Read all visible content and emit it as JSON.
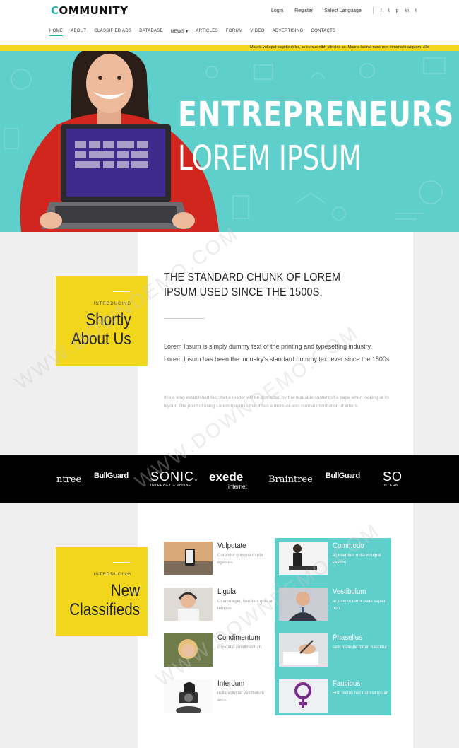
{
  "header": {
    "logo_first": "C",
    "logo_rest": "OMMUNITY",
    "login": "Login",
    "register": "Register",
    "language": "Select Language",
    "social": [
      "f",
      "t",
      "p",
      "in",
      "t"
    ]
  },
  "nav": {
    "items": [
      "HOME",
      "ABOUT",
      "CLASSIFIED ADS",
      "DATABASE",
      "NEWS ▾",
      "ARTICLES",
      "FORUM",
      "VIDEO",
      "ADVERTISING",
      "CONTACTS"
    ]
  },
  "ticker": {
    "text": "Mauris volutpat sagittis dolor, ac cursus nibh ultricies ac. Mauris lacinia nunc non venenatis aliquam. Aliq"
  },
  "hero": {
    "title1": "ENTREPRENEURS",
    "title2": "LOREM IPSUM"
  },
  "about": {
    "intro": "INTRODUCING",
    "title_line1": "Shortly",
    "title_line2": "About Us",
    "heading": "THE STANDARD CHUNK OF LOREM IPSUM USED SINCE THE 1500S.",
    "paragraph1": "Lorem Ipsum is simply dummy text of the printing and typesetting industry. Lorem Ipsum has been the industry's standard dummy text ever since the 1500s",
    "paragraph2": "It is a long established fact that a reader will be distracted by the readable content of a page when looking at its layout. The point of using Lorem Ipsum is that it has a more-or-less normal distribution of letters."
  },
  "brands": [
    "ntree",
    "BullGuard",
    "SONIC.",
    "INTERNET + PHONE",
    "exede",
    "internet",
    "Braintree",
    "BullGuard",
    "SO",
    "INTERN"
  ],
  "classifieds": {
    "intro": "INTRODUCING",
    "title_line1": "New",
    "title_line2": "Classifieds",
    "items": [
      {
        "title": "Vulputate",
        "desc": "Curabitur quisque morbi egestas."
      },
      {
        "title": "Commodo",
        "desc": "ac interdum nulla volutpat vestibu"
      },
      {
        "title": "Ligula",
        "desc": "Ut arcu eget, faucibus quis at tempus"
      },
      {
        "title": "Vestibulum",
        "desc": "at justo ut tortor pede sapien non"
      },
      {
        "title": "Condimentum",
        "desc": "cupidatat condimentum."
      },
      {
        "title": "Phasellus",
        "desc": "sem molestie tortor. nascetur"
      },
      {
        "title": "Interdum",
        "desc": "nulla volutpat vestibulum arcu."
      },
      {
        "title": "Faucibus",
        "desc": "Erat metus nec nam sit ipsum"
      }
    ]
  },
  "watermark": "WWW.DOWNDEMO.COM",
  "colors": {
    "teal": "#5ecfcb",
    "yellow": "#f2d61c",
    "accent": "#1cb3ae"
  }
}
